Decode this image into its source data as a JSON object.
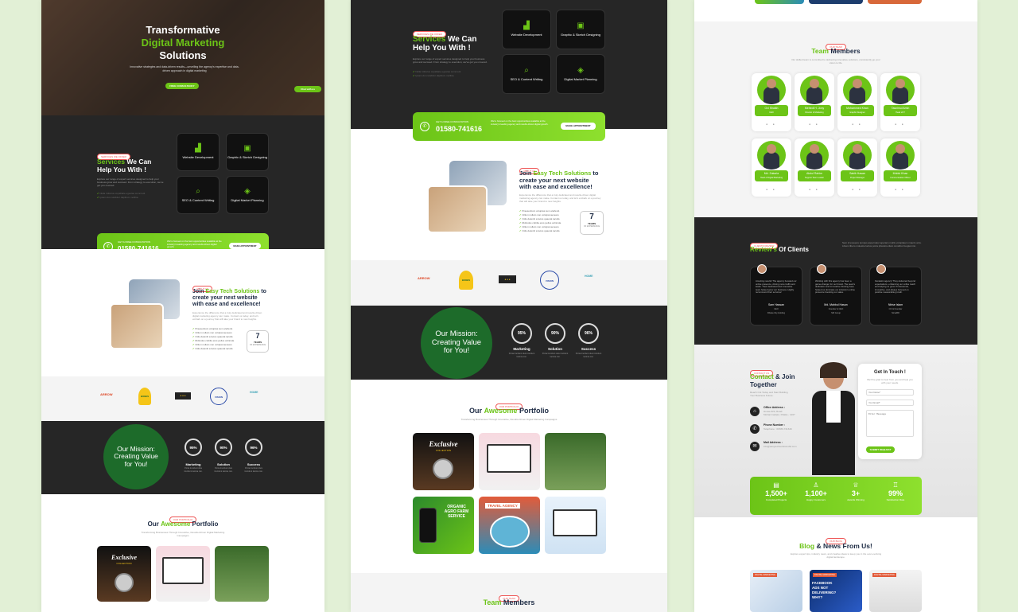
{
  "hero": {
    "title1": "Transformative",
    "title2": "Digital Marketing",
    "title3": "Solutions",
    "desc": "Innovative strategies and data-driven results—unveiling the agency's expertise and data-driven approach in digital marketing",
    "cta": "FREE CONSULTANCY",
    "chat": "Chat with us"
  },
  "services": {
    "tag": "SERVICES WE OFFER",
    "title_green": "Services",
    "title_rest": "We Can",
    "title_line2": "Help You With !",
    "desc": "Explore our range of expert services designed to help your business grow and succeed. From strategy to execution, we've got you covered.",
    "bullet1": "Nulla ridiculus cupiditate egestas commodi.",
    "bullet2": "Ipsam dui curabitur dapibum mollitia.",
    "cards": [
      {
        "label": "Website Development",
        "icon": "chart-icon"
      },
      {
        "label": "Graphic & Sketch Designing",
        "icon": "design-icon"
      },
      {
        "label": "SEO & Content Writing",
        "icon": "seo-icon"
      },
      {
        "label": "Digital Market Planning",
        "icon": "planning-icon"
      }
    ]
  },
  "call": {
    "label": "GET A FREE CONSULTATION",
    "phone": "01580-741616",
    "text": "We're focused on the best opportunities available at the industry's leading agency and results-driven digital growth.",
    "button": "MAKE APPOINTMENT"
  },
  "about": {
    "tag": "ABOUT US",
    "title_pre": "Join",
    "title_green": "Easy Tech Solutions",
    "title_post": "to",
    "title_line2": "create your next website",
    "title_line3": "with ease and excellence!",
    "desc": "Experience the difference that a truly dedicated and results-driven digital marketing agency can make. Contact us today, and let's embark on a journey that will take your brand to new heights.",
    "bullets": [
      "Praesentium voluptas sum eleifend.",
      "Cillum nullam non volutpat aenean.",
      "Odio deleniti a lacus quaerat iaculis.",
      "Ridiculus cubilia eros pellus vehicula.",
      "Cillum nullam non volutpat aenean.",
      "Odio deleniti a lacus quaerat iaculis."
    ],
    "years": "7",
    "years_label": "YEARS",
    "years_sub": "OF EXPERIENCE"
  },
  "logos": [
    "ARROW",
    "BIOBIS",
    "● ● ●",
    "VISION",
    "HOME"
  ],
  "mission": {
    "title": "Our Mission: Creating Value for You!",
    "stats": [
      {
        "value": "95%",
        "label": "Marketing",
        "sub": "Porta tincidunt duis tincidunt lacinia nisi."
      },
      {
        "value": "90%",
        "label": "Solution",
        "sub": "Porta tincidunt duis tincidunt lacinia nisi."
      },
      {
        "value": "96%",
        "label": "Success",
        "sub": "Porta tincidunt duis tincidunt lacinia nisi."
      }
    ]
  },
  "portfolio": {
    "tag": "OUR PORTFOLIO",
    "title_pre": "Our",
    "title_green": "Awesome",
    "title_post": "Portfolio",
    "desc": "Transforming Businesses Through Innovative, Results-Driven Digital Marketing Campaigns",
    "items": [
      {
        "label": "Exclusive",
        "sub": "COLLECTION"
      },
      {
        "label": "",
        "sub": ""
      },
      {
        "label": "",
        "sub": ""
      },
      {
        "label": "ORGANIC AGRO FARM SERVICE",
        "sub": ""
      },
      {
        "label": "TRAVEL AGENCY",
        "sub": ""
      },
      {
        "label": "",
        "sub": ""
      }
    ]
  },
  "team": {
    "tag": "OUR TEAM",
    "title_green": "Team",
    "title_rest": "Members",
    "desc": "Our skilled team is committed to delivering innovative solutions, consistently go your vision to life.",
    "members": [
      {
        "name": "Oxi Shaikh",
        "role": "CEO"
      },
      {
        "name": "Mehedi H. Jony",
        "role": "Director of Marketing"
      },
      {
        "name": "Mohammed Khan",
        "role": "Graphic Designer"
      },
      {
        "name": "Tasnimul Amin",
        "role": "Head of IT"
      },
      {
        "name": "Md. Zakaria",
        "role": "Head of Digital Marketing"
      },
      {
        "name": "Abdul Rahim",
        "role": "Support Team Leader"
      },
      {
        "name": "Sakib Hasan",
        "role": "Project Manager"
      },
      {
        "name": "Mridul Khan",
        "role": "Communication Officer"
      }
    ]
  },
  "reviews": {
    "tag": "CLIENTS REVIEW",
    "title_green": "Review's",
    "title_rest": "Of Clients",
    "desc": "Sem id posuere tempus aspernatur aperiam mollis voluptatem mauris arcu. Libero libero molestie luctus porta pharetra diam curabitur feugiat nisi.",
    "items": [
      {
        "text": "Amazing results! The agency boosted our online presence, driving more traffic and leads. Their dedicated and innovative team helped grow our business. Highly recommend their services!",
        "name": "Sam Hassan",
        "role": "CEO",
        "company": "Dhaka City Holding"
      },
      {
        "text": "Working with this agency has been a game-changer for our brand. The team's dedication and innovative thinking have helped us dominate our industry's online presence boosting our sales.",
        "name": "Md. Mahbul Hasan",
        "role": "Founder & CEO",
        "company": "SM Group"
      },
      {
        "text": "Fantastic agency! They delivered beyond expectations, enhancing our online reach and helping us grow. Professional, innovative, and always focused on positive measurable growth.",
        "name": "Nirise Islam",
        "role": "CO & Founder",
        "company": "NirsaBD"
      }
    ]
  },
  "contact": {
    "tag": "CONTACT US",
    "title_green": "Contact",
    "title_rest": "& Join",
    "title_line2": "Together",
    "desc": "Reach Out Today and Start Building Your Business Future.",
    "office_label": "Office Address :",
    "office_value": "House #20, Road: Mohammadpur, Dhaka - 1207",
    "phone_label": "Phone Number :",
    "phone_value": "Telephone : 01580-741616",
    "mail_label": "Mail Address :",
    "mail_value": "info@easytechsolutionsbd.com",
    "form_title": "Get In Touch !",
    "form_desc": "We'll be glad to hear from you and help you with your needs.",
    "ph_name": "Your Name*",
    "ph_email": "Your Email*",
    "ph_message": "Enter Message",
    "submit": "SUBMIT REQUEST"
  },
  "counters": [
    {
      "value": "1,500+",
      "label": "Completed Projects",
      "icon": "document-icon"
    },
    {
      "value": "1,100+",
      "label": "Happy Customers",
      "icon": "user-icon"
    },
    {
      "value": "3+",
      "label": "Awards Winning",
      "icon": "trophy-icon"
    },
    {
      "value": "99%",
      "label": "Satisfaction Rate",
      "icon": "team-icon"
    }
  ],
  "blog": {
    "tag": "OUR BLOG",
    "title_green": "Blog",
    "title_rest": "& News From Us!",
    "desc": "Explore expert tips, industry news, and creative ideas to keep you in the ever-evolving digital landscape.",
    "items": [
      {
        "badge": "DIGITAL MARKETING",
        "caption": ""
      },
      {
        "badge": "DIGITAL MARKETING",
        "caption": "FACEBOOK ADS NOT DELIVERING? WHY?"
      },
      {
        "badge": "DIGITAL MARKETING",
        "caption": ""
      }
    ]
  }
}
